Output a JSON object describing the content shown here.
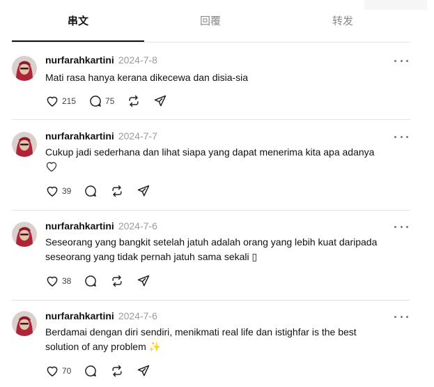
{
  "tabs": [
    {
      "label": "串文",
      "active": true
    },
    {
      "label": "回覆",
      "active": false
    },
    {
      "label": "转发",
      "active": false
    }
  ],
  "posts": [
    {
      "username": "nurfarahkartini",
      "date": "2024-7-8",
      "lines": [
        "Mati rasa hanya kerana dikecewa dan disia-sia"
      ],
      "likes": "215",
      "replies": "75"
    },
    {
      "username": "nurfarahkartini",
      "date": "2024-7-7",
      "lines": [
        "Cukup jadi sederhana dan lihat siapa yang dapat menerima kita apa adanya"
      ],
      "emoji": "heart-outline-emoji",
      "likes": "39",
      "replies": ""
    },
    {
      "username": "nurfarahkartini",
      "date": "2024-7-6",
      "lines": [
        "Seseorang yang bangkit setelah jatuh adalah orang yang lebih kuat daripada",
        "seseorang yang tidak pernah jatuh sama sekali ▯"
      ],
      "likes": "38",
      "replies": ""
    },
    {
      "username": "nurfarahkartini",
      "date": "2024-7-6",
      "lines": [
        "Berdamai dengan diri sendiri, menikmati real life dan istighfar is the best",
        "solution of any problem ✨"
      ],
      "likes": "70",
      "replies": ""
    }
  ],
  "icons": {
    "like": "heart-icon",
    "reply": "speech-bubble-icon",
    "repost": "repost-icon",
    "share": "send-icon",
    "more": "more-dots-icon"
  },
  "colors": {
    "text": "#111111",
    "muted": "#9a9a9a",
    "divider": "#e3e3e3",
    "avatar_hijab": "#b0243a"
  }
}
